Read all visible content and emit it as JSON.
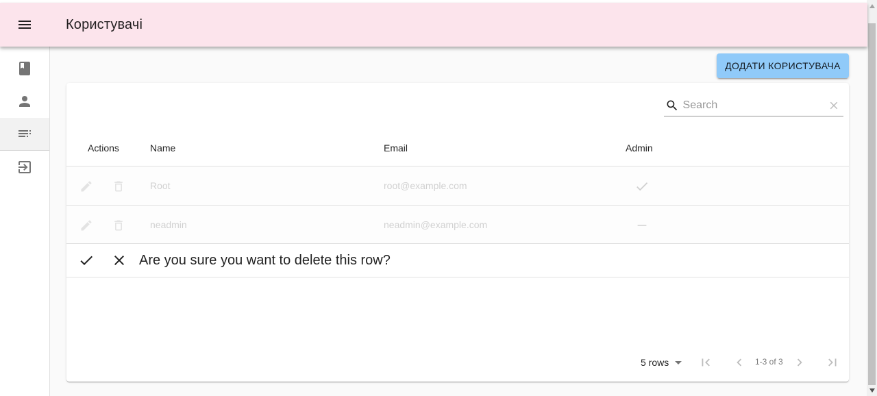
{
  "appbar": {
    "title": "Користувачі",
    "menu_icon": "menu-icon"
  },
  "drawer": {
    "items": [
      {
        "name": "book-icon",
        "active": false
      },
      {
        "name": "person-icon",
        "active": false
      },
      {
        "name": "list-icon",
        "active": true
      },
      {
        "name": "login-icon",
        "active": false
      }
    ]
  },
  "actions": {
    "add_user_label": "ДОДАТИ КОРИСТУВАЧА"
  },
  "search": {
    "placeholder": "Search",
    "value": ""
  },
  "table": {
    "columns": [
      "Actions",
      "Name",
      "Email",
      "Admin"
    ],
    "rows": [
      {
        "name": "Root",
        "email": "root@example.com",
        "admin": "check"
      },
      {
        "name": "neadmin",
        "email": "neadmin@example.com",
        "admin": "dash"
      }
    ],
    "confirm_text": "Are you sure you want to delete this row?"
  },
  "pagination": {
    "rows_per_page": "5 rows",
    "range_label": "1-3 of 3"
  },
  "colors": {
    "appbar_bg": "#fce4ec",
    "button_bg": "#90caf9"
  }
}
